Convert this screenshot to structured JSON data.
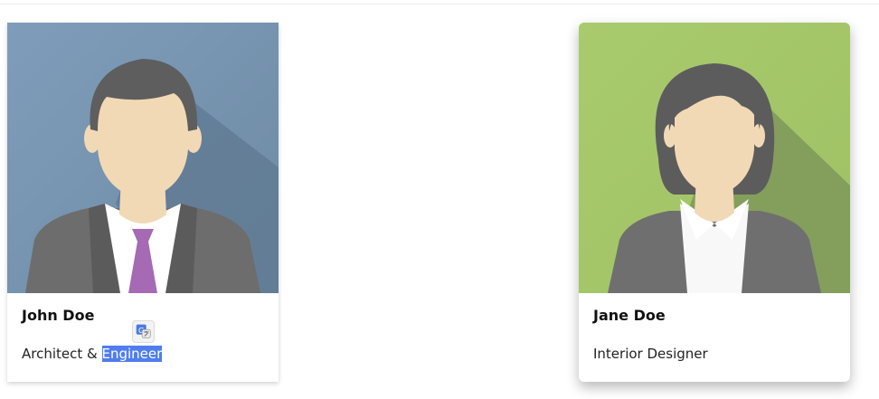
{
  "cards": [
    {
      "name": "John Doe",
      "title_plain": "Architect & ",
      "title_selected": "Engineer",
      "image_icon": "male-avatar-icon",
      "image_bg": "#7a9ab6"
    },
    {
      "name": "Jane Doe",
      "title": "Interior Designer",
      "image_icon": "female-avatar-icon",
      "image_bg": "#a7c96c"
    }
  ],
  "selection_popup": {
    "icon": "translate-icon"
  }
}
